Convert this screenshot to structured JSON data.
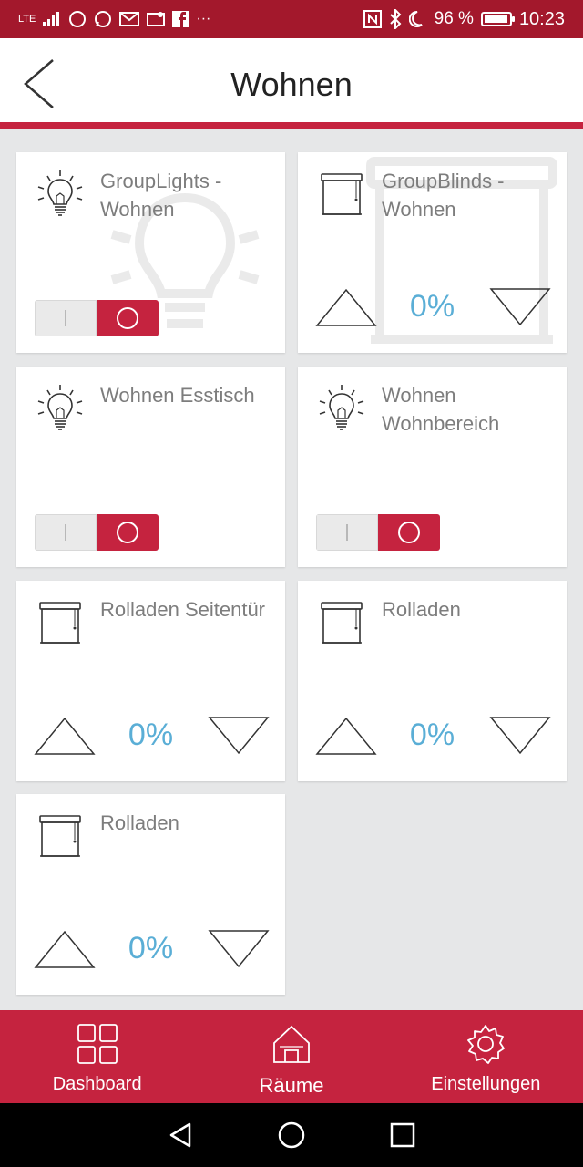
{
  "status_bar": {
    "network": "LTE",
    "battery_percent": "96 %",
    "battery_level": 0.96,
    "time": "10:23"
  },
  "header": {
    "title": "Wohnen"
  },
  "tiles": [
    {
      "type": "light",
      "label": "GroupLights - Wohnen",
      "state": "on"
    },
    {
      "type": "blind",
      "label": "GroupBlinds - Wohnen",
      "percent": "0%"
    },
    {
      "type": "light",
      "label": "Wohnen Esstisch",
      "state": "on"
    },
    {
      "type": "light",
      "label": "Wohnen Wohnbereich",
      "state": "on"
    },
    {
      "type": "blind",
      "label": "Rolladen Seitentür",
      "percent": "0%"
    },
    {
      "type": "blind",
      "label": "Rolladen",
      "percent": "0%"
    },
    {
      "type": "blind",
      "label": "Rolladen",
      "percent": "0%"
    }
  ],
  "bottom_nav": {
    "items": [
      {
        "label": "Dashboard",
        "icon": "grid-icon"
      },
      {
        "label": "Räume",
        "icon": "house-icon",
        "active": true
      },
      {
        "label": "Einstellungen",
        "icon": "gear-icon"
      }
    ]
  },
  "colors": {
    "brand": "#c5233f",
    "status_bar": "#a3182c",
    "percent": "#5aaed6"
  }
}
